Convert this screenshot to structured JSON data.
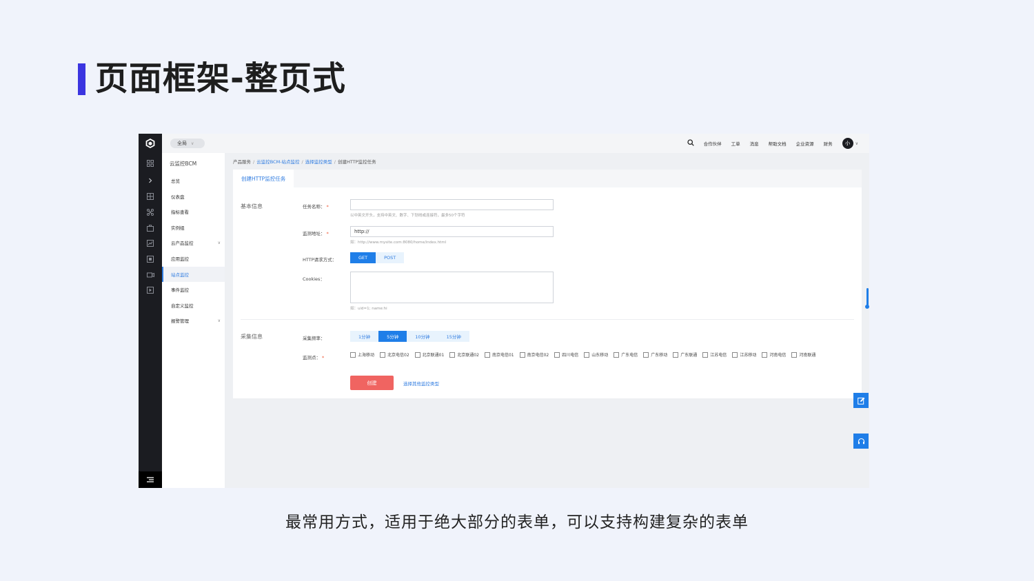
{
  "slide": {
    "title": "页面框架-整页式",
    "caption": "最常用方式，适用于绝大部分的表单，可以支持构建复杂的表单"
  },
  "header": {
    "region": "全局",
    "nav": [
      "合作伙伴",
      "工单",
      "消息",
      "帮助文档",
      "企业资源",
      "财务"
    ],
    "avatar": "小"
  },
  "sidebar": {
    "title": "云监控BCM",
    "items": [
      {
        "label": "总览",
        "expandable": false,
        "active": false
      },
      {
        "label": "仪表盘",
        "expandable": false,
        "active": false
      },
      {
        "label": "指标查看",
        "expandable": false,
        "active": false
      },
      {
        "label": "实例组",
        "expandable": false,
        "active": false
      },
      {
        "label": "云产品监控",
        "expandable": true,
        "active": false
      },
      {
        "label": "应用监控",
        "expandable": false,
        "active": false
      },
      {
        "label": "站点监控",
        "expandable": false,
        "active": true
      },
      {
        "label": "事件监控",
        "expandable": false,
        "active": false
      },
      {
        "label": "自定义监控",
        "expandable": false,
        "active": false
      },
      {
        "label": "报警管理",
        "expandable": true,
        "active": false
      }
    ]
  },
  "breadcrumb": {
    "items": [
      "产品服务",
      "云监控BCM-站点监控",
      "选择监控类型",
      "创建HTTP监控任务"
    ],
    "separator": "/"
  },
  "tab": {
    "label": "创建HTTP监控任务"
  },
  "form": {
    "basic_section": "基本信息",
    "task_name": {
      "label": "任务名称：",
      "value": "",
      "hint": "以中英文开头，支持中英文、数字、下划线或连接符，最多50个字符"
    },
    "monitor_url": {
      "label": "监测地址：",
      "value": "http://",
      "hint": "如：http://www.mysite.com:8080/home/index.html"
    },
    "method": {
      "label": "HTTP请求方式：",
      "options": [
        "GET",
        "POST"
      ],
      "selected": "GET"
    },
    "cookies": {
      "label": "Cookies：",
      "value": "",
      "hint": "如：uid=1; name:hi"
    },
    "collect_section": "采集信息",
    "frequency": {
      "label": "采集频率：",
      "options": [
        "1分钟",
        "5分钟",
        "10分钟",
        "15分钟"
      ],
      "selected": "5分钟"
    },
    "points": {
      "label": "监测点：",
      "options": [
        "上海移动",
        "北京电信02",
        "北京联通01",
        "北京联通02",
        "南京电信01",
        "南京电信02",
        "四川电信",
        "山东移动",
        "广东电信",
        "广东移动",
        "广东联通",
        "江苏电信",
        "江苏移动",
        "河南电信",
        "河南联通"
      ]
    },
    "create_label": "创建",
    "other_type_label": "选择其他监控类型"
  },
  "colors": {
    "accent": "#1f7ee8",
    "title_bar": "#3b35e0",
    "create_button": "#f06461",
    "icon_bar": "#1b1c21"
  }
}
